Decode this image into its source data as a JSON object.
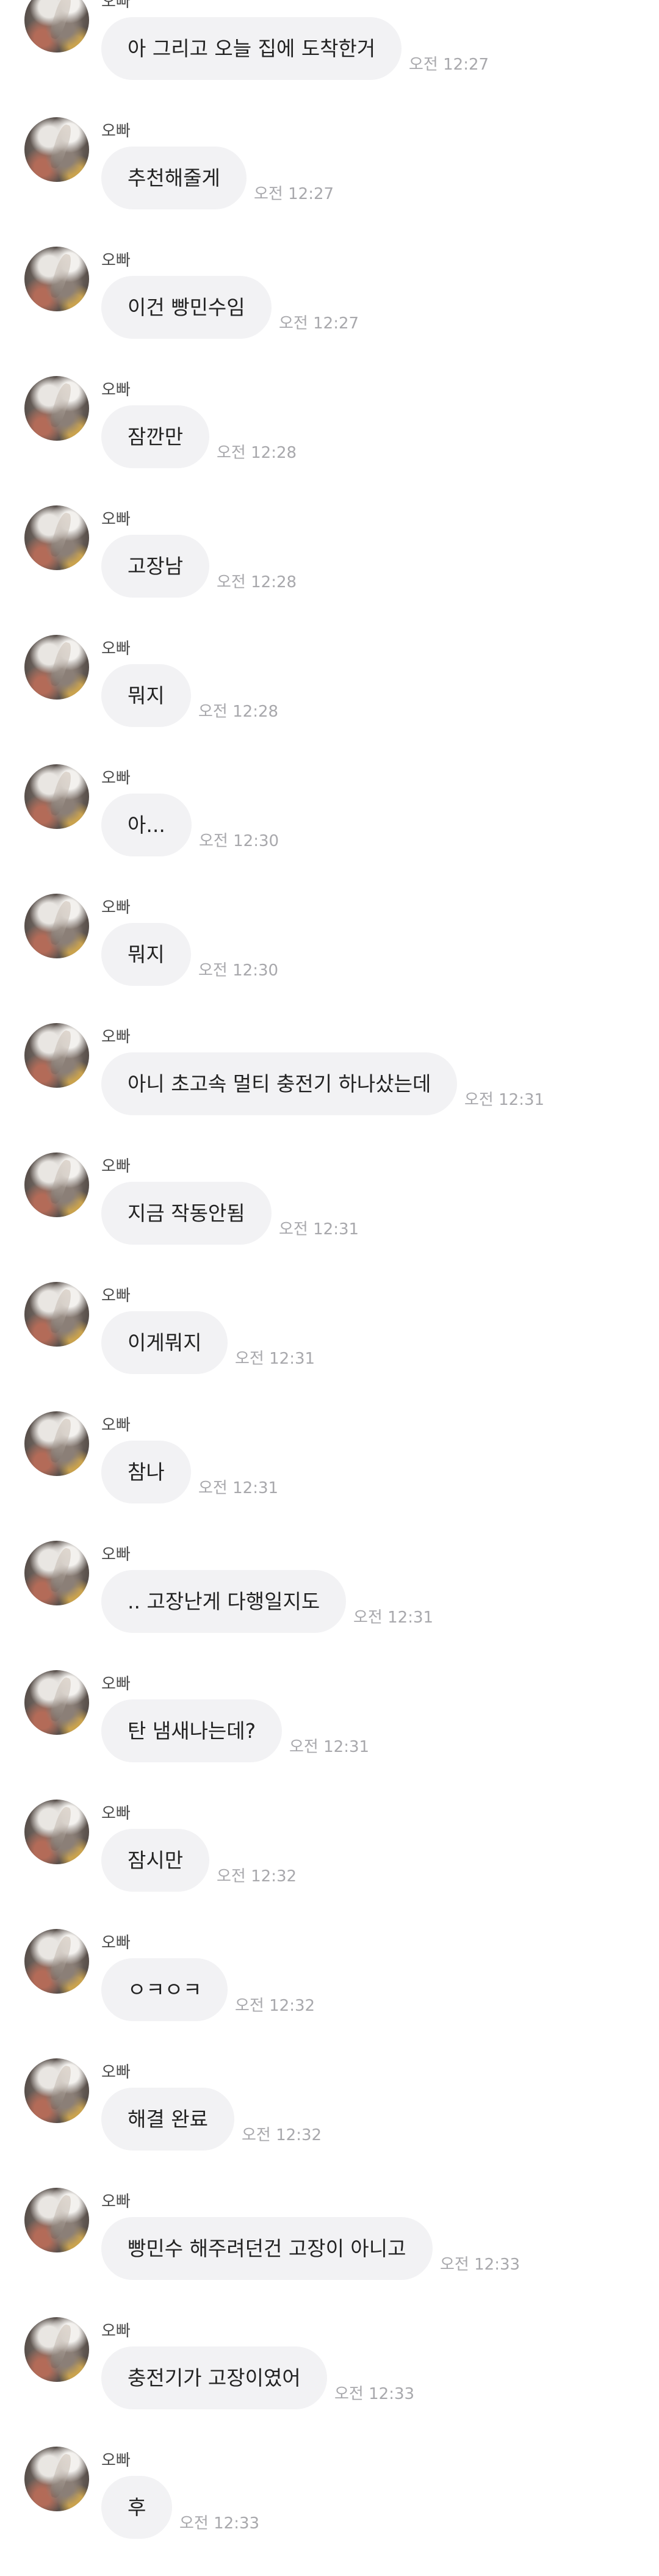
{
  "chat": {
    "messages": [
      {
        "sender": "오빠",
        "text": "아 그리고 오늘 집에 도착한거",
        "time": "오전 12:27"
      },
      {
        "sender": "오빠",
        "text": "추천해줄게",
        "time": "오전 12:27"
      },
      {
        "sender": "오빠",
        "text": "이건 빵민수임",
        "time": "오전 12:27"
      },
      {
        "sender": "오빠",
        "text": "잠깐만",
        "time": "오전 12:28"
      },
      {
        "sender": "오빠",
        "text": "고장남",
        "time": "오전 12:28"
      },
      {
        "sender": "오빠",
        "text": "뭐지",
        "time": "오전 12:28"
      },
      {
        "sender": "오빠",
        "text": "아...",
        "time": "오전 12:30"
      },
      {
        "sender": "오빠",
        "text": "뭐지",
        "time": "오전 12:30"
      },
      {
        "sender": "오빠",
        "text": "아니 초고속 멀티 충전기 하나샀는데",
        "time": "오전 12:31"
      },
      {
        "sender": "오빠",
        "text": "지금 작동안됨",
        "time": "오전 12:31"
      },
      {
        "sender": "오빠",
        "text": "이게뭐지",
        "time": "오전 12:31"
      },
      {
        "sender": "오빠",
        "text": "참나",
        "time": "오전 12:31"
      },
      {
        "sender": "오빠",
        "text": ".. 고장난게 다행일지도",
        "time": "오전 12:31"
      },
      {
        "sender": "오빠",
        "text": "탄 냄새나는데?",
        "time": "오전 12:31"
      },
      {
        "sender": "오빠",
        "text": "잠시만",
        "time": "오전 12:32"
      },
      {
        "sender": "오빠",
        "text": "ㅇㅋㅇㅋ",
        "time": "오전 12:32"
      },
      {
        "sender": "오빠",
        "text": "해결 완료",
        "time": "오전 12:32"
      },
      {
        "sender": "오빠",
        "text": "빵민수 해주려던건 고장이 아니고",
        "time": "오전 12:33"
      },
      {
        "sender": "오빠",
        "text": "충전기가 고장이였어",
        "time": "오전 12:33"
      },
      {
        "sender": "오빠",
        "text": "후",
        "time": "오전 12:33"
      }
    ]
  }
}
